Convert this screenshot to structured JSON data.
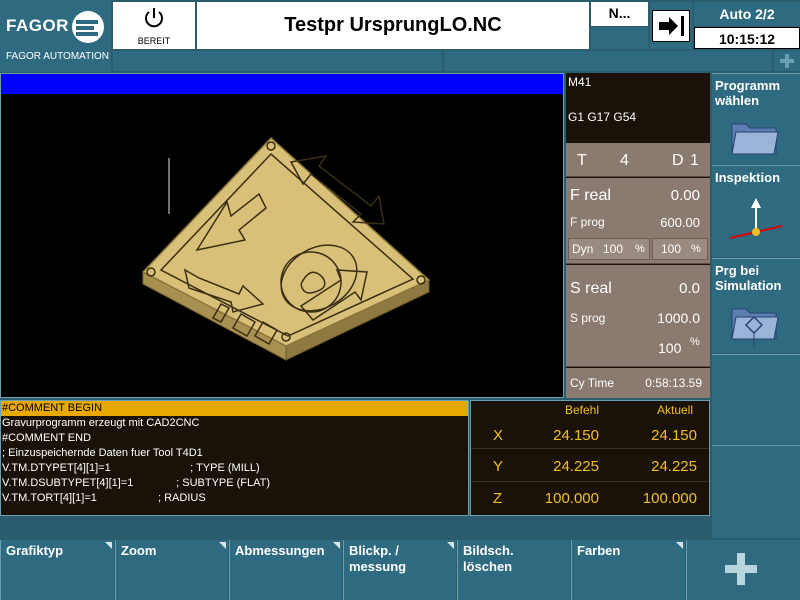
{
  "header": {
    "brand": "FAGOR",
    "brand_sub": "FAGOR AUTOMATION",
    "power_label": "BEREIT",
    "program_title": "Testpr UrsprungLO.NC",
    "n_label": "N...",
    "mode": "Auto 2/2",
    "time": "10:15:12"
  },
  "graphics": {
    "background": "#000000",
    "topbar_color": "#0000ff",
    "part_color": "#d8c078"
  },
  "status": {
    "m_code": "M41",
    "g_codes": "G1 G17 G54",
    "tool_label": "T",
    "tool_value": "4",
    "d_label": "D",
    "d_value": "1",
    "freal_label": "F real",
    "freal_value": "0.00",
    "fprog_label": "F prog",
    "fprog_value": "600.00",
    "dyn_label": "Dyn",
    "dyn_value": "100",
    "dyn_unit": "%",
    "f_override_value": "100",
    "f_override_unit": "%",
    "sreal_label": "S real",
    "sreal_value": "0.0",
    "sprog_label": "S prog",
    "sprog_value": "1000.0",
    "s_override_value": "100",
    "s_override_unit": "%",
    "cytime_label": "Cy Time",
    "cytime_value": "0:58:13.59"
  },
  "right_softkeys": [
    {
      "label": "Programm\nwählen",
      "icon": "folder-icon"
    },
    {
      "label": "Inspektion",
      "icon": "inspection-icon"
    },
    {
      "label": "Prg bei\nSimulation",
      "icon": "folder-simulation-icon"
    },
    {
      "label": ""
    },
    {
      "label": ""
    },
    {
      "label": ""
    }
  ],
  "program_lines": [
    "#COMMENT BEGIN",
    "Gravurprogramm erzeugt mit CAD2CNC",
    "#COMMENT END",
    "; Einzuspeichernde Daten fuer Tool T4D1",
    "V.TM.DTYPET[4][1]=1                          ; TYPE (MILL)",
    "V.TM.DSUBTYPET[4][1]=1              ; SUBTYPE (FLAT)",
    "V.TM.TORT[4][1]=1                    ; RADIUS"
  ],
  "axes": {
    "header_command": "Befehl",
    "header_actual": "Aktuell",
    "rows": [
      {
        "axis": "X",
        "command": "24.150",
        "actual": "24.150"
      },
      {
        "axis": "Y",
        "command": "24.225",
        "actual": "24.225"
      },
      {
        "axis": "Z",
        "command": "100.000",
        "actual": "100.000"
      }
    ]
  },
  "bottom_softkeys": [
    {
      "label": "Grafiktyp"
    },
    {
      "label": "Zoom"
    },
    {
      "label": "Abmessungen"
    },
    {
      "label": "Blickp. /\nmessung"
    },
    {
      "label": "Bildsch.\nlöschen"
    },
    {
      "label": "Farben"
    }
  ],
  "colors": {
    "panel": "#2f6b80",
    "highlight": "#e8a800",
    "axis_text": "#f0c020"
  }
}
